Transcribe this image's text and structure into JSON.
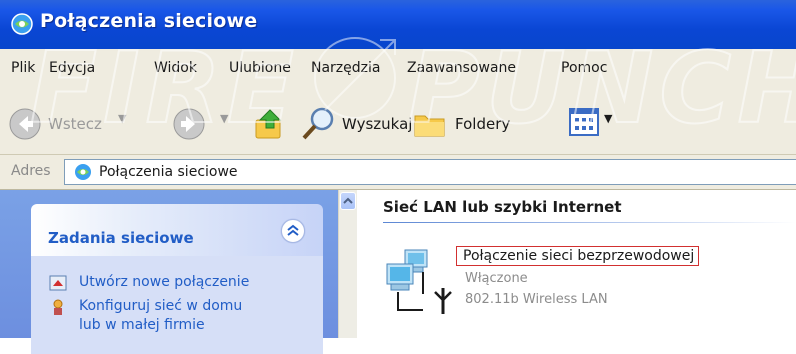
{
  "window": {
    "title": "Połączenia sieciowe"
  },
  "watermark": {
    "text": "FIRE PUNCH"
  },
  "menu": [
    "Plik",
    "Edycja",
    "Widok",
    "Ulubione",
    "Narzędzia",
    "Zaawansowane",
    "Pomoc"
  ],
  "toolbar": {
    "back_label": "Wstecz",
    "search_label": "Wyszukaj",
    "folders_label": "Foldery"
  },
  "address": {
    "label": "Adres",
    "value": "Połączenia sieciowe"
  },
  "tasks": {
    "title": "Zadania sieciowe",
    "items": [
      {
        "label": "Utwórz nowe połączenie",
        "icon": "new-connection-icon"
      },
      {
        "label_line1": "Konfiguruj sieć w domu",
        "label_line2": "lub w małej firmie",
        "icon": "home-network-wizard-icon"
      }
    ]
  },
  "content": {
    "group_title": "Sieć LAN lub szybki Internet",
    "connection": {
      "name": "Połączenie sieci bezprzewodowej",
      "status": "Włączone",
      "device": "802.11b Wireless LAN"
    }
  },
  "colors": {
    "titlebar": "#0a46d4",
    "link_blue": "#215dc6",
    "highlight_border": "#d23030",
    "panel_blue": "#6d8fdf"
  }
}
